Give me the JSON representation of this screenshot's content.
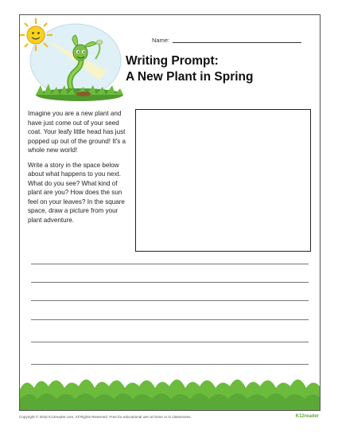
{
  "worksheet": {
    "name_label": "Name:",
    "title_line1": "Writing Prompt:",
    "title_line2": "A New Plant in Spring",
    "prompt_paragraph1": "Imagine you are a new plant and have just come out of your seed coat. Your leafy little head has just popped up out of the ground! It's a whole new world!",
    "prompt_paragraph2": "Write a story in the space below about what happens to you next. What do you see? What kind of plant are you? How does the sun feel on your leaves? In the square space, draw a picture from your plant adventure.",
    "writing_line_count": 6
  },
  "footer": {
    "copyright": "Copyright © 2015 K12reader.com. All Rights Reserved. Free for educational use at home or in classrooms.",
    "logo_text": "K12reader"
  },
  "colors": {
    "grass": "#5fae3a",
    "grass_dark": "#3f8a25",
    "sun": "#f7d21e",
    "sprout": "#7bc043"
  }
}
